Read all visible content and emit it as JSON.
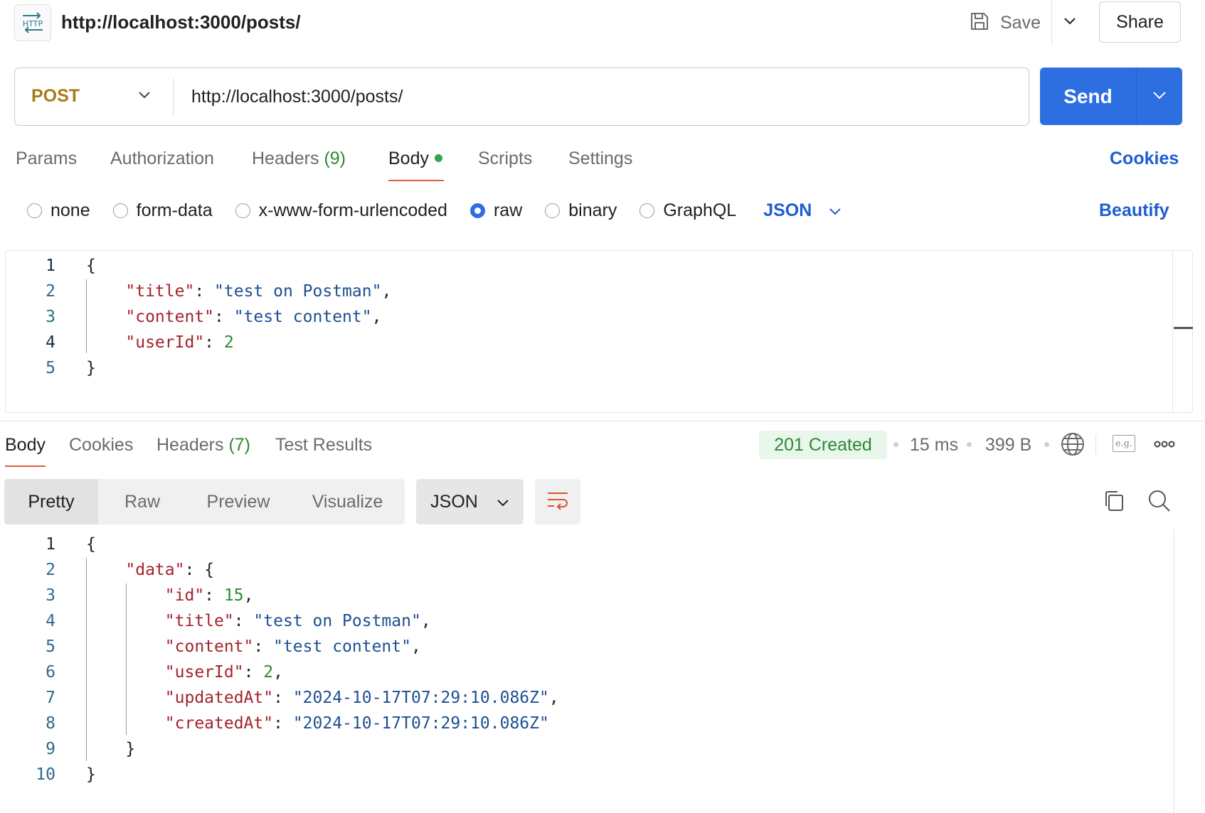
{
  "header": {
    "icon_label": "HTTP",
    "title": "http://localhost:3000/posts/",
    "save_label": "Save",
    "share_label": "Share"
  },
  "request": {
    "method": "POST",
    "url": "http://localhost:3000/posts/",
    "send_label": "Send"
  },
  "request_tabs": [
    {
      "label": "Params"
    },
    {
      "label": "Authorization"
    },
    {
      "label": "Headers",
      "count": "(9)"
    },
    {
      "label": "Body",
      "active": true
    },
    {
      "label": "Scripts"
    },
    {
      "label": "Settings"
    }
  ],
  "cookies_label": "Cookies",
  "body_types": [
    {
      "label": "none",
      "checked": false
    },
    {
      "label": "form-data",
      "checked": false
    },
    {
      "label": "x-www-form-urlencoded",
      "checked": false
    },
    {
      "label": "raw",
      "checked": true
    },
    {
      "label": "binary",
      "checked": false
    },
    {
      "label": "GraphQL",
      "checked": false
    }
  ],
  "raw_format": "JSON",
  "beautify_label": "Beautify",
  "request_body": {
    "line_numbers": [
      "1",
      "2",
      "3",
      "4",
      "5"
    ],
    "open_brace": "{",
    "close_brace": "}",
    "title_key": "\"title\"",
    "title_value": "\"test on Postman\"",
    "content_key": "\"content\"",
    "content_value": "\"test content\"",
    "userid_key": "\"userId\"",
    "userid_value": "2"
  },
  "response_tabs": [
    {
      "label": "Body",
      "active": true
    },
    {
      "label": "Cookies"
    },
    {
      "label": "Headers",
      "count": "(7)"
    },
    {
      "label": "Test Results"
    }
  ],
  "response_meta": {
    "status": "201 Created",
    "time": "15 ms",
    "size": "399 B",
    "example_label": "e.g."
  },
  "response_views": [
    "Pretty",
    "Raw",
    "Preview",
    "Visualize"
  ],
  "response_format": "JSON",
  "response_body": {
    "line_numbers": [
      "1",
      "2",
      "3",
      "4",
      "5",
      "6",
      "7",
      "8",
      "9",
      "10"
    ],
    "open_brace": "{",
    "close_brace": "}",
    "data_key": "\"data\"",
    "id_key": "\"id\"",
    "id_value": "15",
    "title_key": "\"title\"",
    "title_value": "\"test on Postman\"",
    "content_key": "\"content\"",
    "content_value": "\"test content\"",
    "userid_key": "\"userId\"",
    "userid_value": "2",
    "updated_key": "\"updatedAt\"",
    "updated_value": "\"2024-10-17T07:29:10.086Z\"",
    "created_key": "\"createdAt\"",
    "created_value": "\"2024-10-17T07:29:10.086Z\""
  },
  "colors": {
    "accent": "#2d6ee0",
    "method_post": "#a77b1c",
    "tab_underline": "#e25d3a",
    "status_success": "#2d8a34",
    "json_key": "#a3232c",
    "json_string": "#1d4f91",
    "json_number": "#2d8a34"
  },
  "icons": [
    "http-icon",
    "save-icon",
    "chevron-down-icon",
    "globe-icon",
    "example-icon",
    "more-icon",
    "wrap-lines-icon",
    "copy-icon",
    "search-icon"
  ]
}
